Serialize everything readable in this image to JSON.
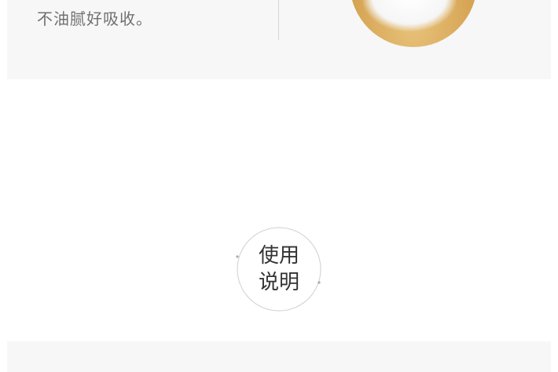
{
  "feature_section": {
    "text": "不油腻好吸收。"
  },
  "usage_badge": {
    "line1": "使用",
    "line2": "说明"
  }
}
